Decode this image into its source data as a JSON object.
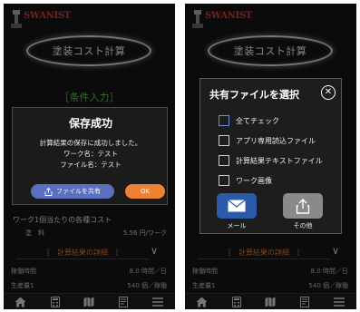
{
  "brand": {
    "name": "SWANIST"
  },
  "header": {
    "title": "塗装コスト計算"
  },
  "left": {
    "section_label": "［条件入力］",
    "modal": {
      "title": "保存成功",
      "message": "計算結果の保存に成功しました。",
      "work_name_line": "ワーク名：テスト",
      "file_name_line": "ファイル名：テスト",
      "share_label": "ファイルを共有",
      "ok_label": "OK"
    },
    "under": {
      "per_work_title": "ワーク1個当たりの各種コスト",
      "paint_label": "塗　料",
      "paint_value": "5.56 円/ワーク",
      "detail_label": "［　計算結果の詳細　］",
      "row1_label": "稼働時間",
      "row1_value": "8.0 時間／日",
      "row2_label": "生産量1",
      "row2_value": "540 個／稼働"
    }
  },
  "right": {
    "modal": {
      "title": "共有ファイルを選択",
      "options": [
        {
          "label": "全てチェック"
        },
        {
          "label": "アプリ専用読込ファイル"
        },
        {
          "label": "計算結果テキストファイル"
        },
        {
          "label": "ワーク画像"
        }
      ],
      "mail_label": "メール",
      "other_label": "その他"
    },
    "under": {
      "detail_label": "［　計算結果の詳細　］",
      "row1_label": "稼働時間",
      "row1_value": "8.0 時間／日",
      "row2_label": "生産量1",
      "row2_value": "540 個／稼働"
    }
  },
  "nav": {
    "icons": [
      "home-icon",
      "calculator-icon",
      "map-icon",
      "document-icon",
      "menu-icon"
    ]
  },
  "colors": {
    "background": "#151515",
    "accent_green": "#5fc14f",
    "accent_orange": "#e07a37",
    "share_button": "#5b6fbf",
    "ok_button": "#ef8132",
    "mail_button": "#2b5aa8",
    "other_button": "#8a8a8a",
    "brand_red": "#d93a3a"
  }
}
